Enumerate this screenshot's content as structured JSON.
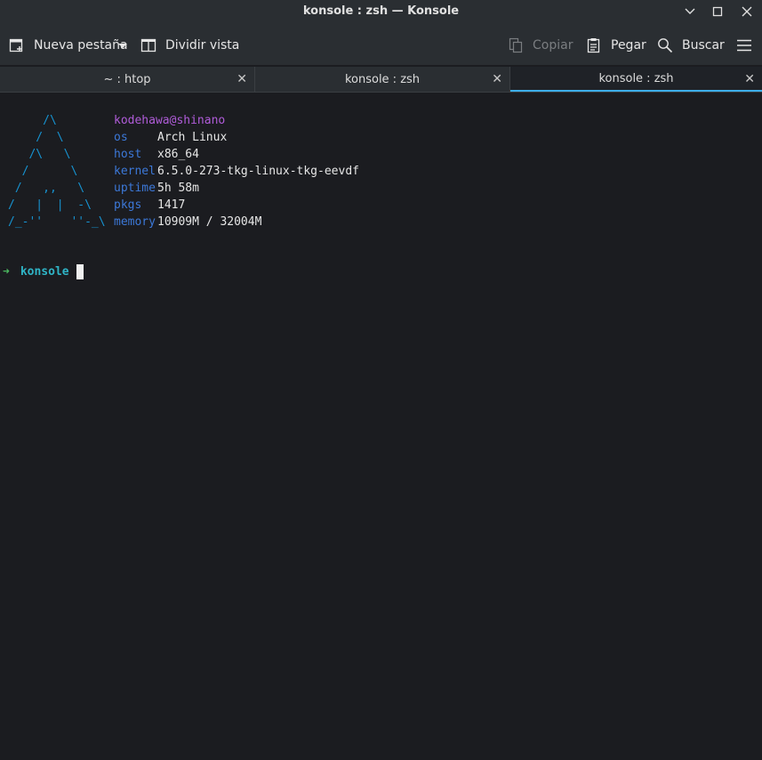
{
  "window": {
    "title": "konsole : zsh — Konsole"
  },
  "toolbar": {
    "new_tab_label": "Nueva pestaña",
    "split_view_label": "Dividir vista",
    "copy_label": "Copiar",
    "paste_label": "Pegar",
    "search_label": "Buscar"
  },
  "tabs": [
    {
      "label": "~ : htop",
      "active": false
    },
    {
      "label": "konsole : zsh",
      "active": false
    },
    {
      "label": "konsole : zsh",
      "active": true
    }
  ],
  "terminal": {
    "ascii_art": "     /\\\n    /  \\\n   /\\   \\\n  /      \\\n /   ,,   \\\n/   |  |  -\\\n/_-''    ''-_\\",
    "user_host": "kodehawa@shinano",
    "info": [
      {
        "key": "os",
        "value": "Arch Linux"
      },
      {
        "key": "host",
        "value": "x86_64"
      },
      {
        "key": "kernel",
        "value": "6.5.0-273-tkg-linux-tkg-eevdf"
      },
      {
        "key": "uptime",
        "value": "5h 58m"
      },
      {
        "key": "pkgs",
        "value": "1417"
      },
      {
        "key": "memory",
        "value": "10909M / 32004M"
      }
    ],
    "prompt_symbol": "➜",
    "prompt_dir": "konsole"
  },
  "colors": {
    "accent": "#3daee9",
    "logo": "#1793d1",
    "key": "#3c78d8",
    "user": "#b05cd9",
    "prompt_arrow": "#4ab85f",
    "prompt_dir": "#2fb4c6"
  },
  "icons": {
    "new_tab": "new-tab-icon",
    "dropdown": "chevron-down-icon",
    "split": "split-view-icon",
    "copy": "copy-icon",
    "paste": "paste-icon",
    "search": "search-icon",
    "menu": "hamburger-menu-icon",
    "minimize": "minimize-icon",
    "maximize": "maximize-icon",
    "close": "close-icon"
  }
}
